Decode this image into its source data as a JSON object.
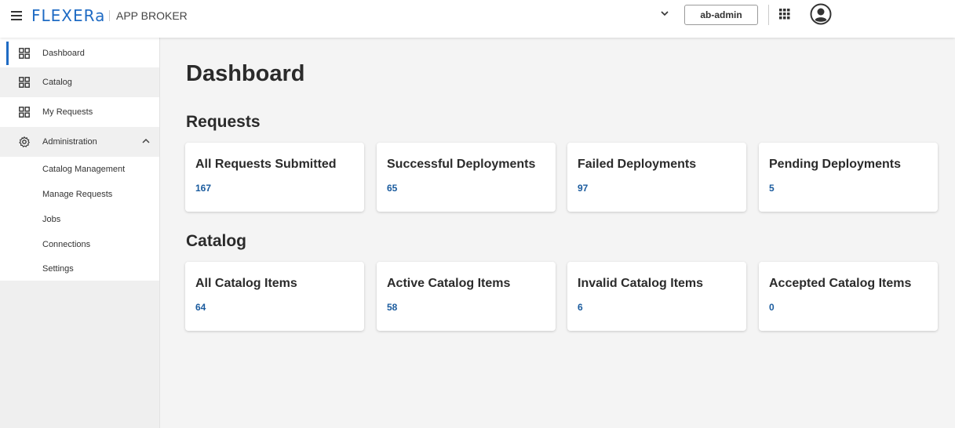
{
  "header": {
    "logo_text": "FLEXERa",
    "product_name": "APP BROKER",
    "user_name": "ab-admin",
    "brand_color": "#1f6bc4",
    "icons": [
      "hamburger-icon",
      "chevron-down-icon",
      "apps-grid-icon",
      "user-avatar-icon"
    ]
  },
  "sidebar": {
    "items": [
      {
        "label": "Dashboard",
        "icon": "dashboard-grid-icon",
        "active": true
      },
      {
        "label": "Catalog",
        "icon": "dashboard-grid-icon"
      },
      {
        "label": "My Requests",
        "icon": "dashboard-grid-icon"
      },
      {
        "label": "Administration",
        "icon": "gear-icon",
        "expanded": true
      }
    ],
    "sub_items": [
      {
        "label": "Catalog Management"
      },
      {
        "label": "Manage Requests"
      },
      {
        "label": "Jobs"
      },
      {
        "label": "Connections"
      },
      {
        "label": "Settings"
      }
    ]
  },
  "main": {
    "title": "Dashboard",
    "sections": [
      {
        "title": "Requests",
        "cards": [
          {
            "title": "All Requests Submitted",
            "value": "167"
          },
          {
            "title": "Successful Deployments",
            "value": "65"
          },
          {
            "title": "Failed Deployments",
            "value": "97"
          },
          {
            "title": "Pending Deployments",
            "value": "5"
          }
        ]
      },
      {
        "title": "Catalog",
        "cards": [
          {
            "title": "All Catalog Items",
            "value": "64"
          },
          {
            "title": "Active Catalog Items",
            "value": "58"
          },
          {
            "title": "Invalid Catalog Items",
            "value": "6"
          },
          {
            "title": "Accepted Catalog Items",
            "value": "0"
          }
        ]
      }
    ],
    "value_color": "#1a5b9e"
  }
}
